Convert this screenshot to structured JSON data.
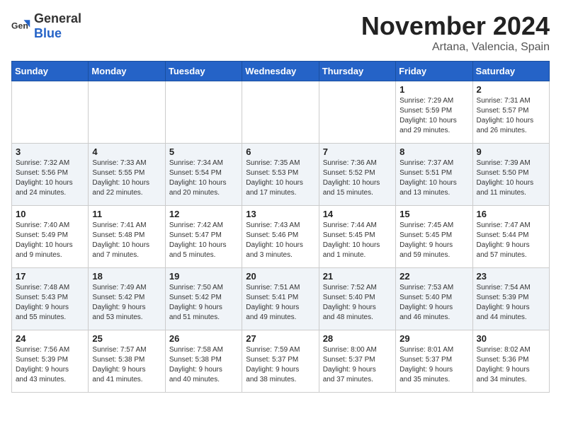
{
  "header": {
    "logo_general": "General",
    "logo_blue": "Blue",
    "month_title": "November 2024",
    "location": "Artana, Valencia, Spain"
  },
  "weekdays": [
    "Sunday",
    "Monday",
    "Tuesday",
    "Wednesday",
    "Thursday",
    "Friday",
    "Saturday"
  ],
  "weeks": [
    [
      {
        "day": "",
        "info": ""
      },
      {
        "day": "",
        "info": ""
      },
      {
        "day": "",
        "info": ""
      },
      {
        "day": "",
        "info": ""
      },
      {
        "day": "",
        "info": ""
      },
      {
        "day": "1",
        "info": "Sunrise: 7:29 AM\nSunset: 5:59 PM\nDaylight: 10 hours\nand 29 minutes."
      },
      {
        "day": "2",
        "info": "Sunrise: 7:31 AM\nSunset: 5:57 PM\nDaylight: 10 hours\nand 26 minutes."
      }
    ],
    [
      {
        "day": "3",
        "info": "Sunrise: 7:32 AM\nSunset: 5:56 PM\nDaylight: 10 hours\nand 24 minutes."
      },
      {
        "day": "4",
        "info": "Sunrise: 7:33 AM\nSunset: 5:55 PM\nDaylight: 10 hours\nand 22 minutes."
      },
      {
        "day": "5",
        "info": "Sunrise: 7:34 AM\nSunset: 5:54 PM\nDaylight: 10 hours\nand 20 minutes."
      },
      {
        "day": "6",
        "info": "Sunrise: 7:35 AM\nSunset: 5:53 PM\nDaylight: 10 hours\nand 17 minutes."
      },
      {
        "day": "7",
        "info": "Sunrise: 7:36 AM\nSunset: 5:52 PM\nDaylight: 10 hours\nand 15 minutes."
      },
      {
        "day": "8",
        "info": "Sunrise: 7:37 AM\nSunset: 5:51 PM\nDaylight: 10 hours\nand 13 minutes."
      },
      {
        "day": "9",
        "info": "Sunrise: 7:39 AM\nSunset: 5:50 PM\nDaylight: 10 hours\nand 11 minutes."
      }
    ],
    [
      {
        "day": "10",
        "info": "Sunrise: 7:40 AM\nSunset: 5:49 PM\nDaylight: 10 hours\nand 9 minutes."
      },
      {
        "day": "11",
        "info": "Sunrise: 7:41 AM\nSunset: 5:48 PM\nDaylight: 10 hours\nand 7 minutes."
      },
      {
        "day": "12",
        "info": "Sunrise: 7:42 AM\nSunset: 5:47 PM\nDaylight: 10 hours\nand 5 minutes."
      },
      {
        "day": "13",
        "info": "Sunrise: 7:43 AM\nSunset: 5:46 PM\nDaylight: 10 hours\nand 3 minutes."
      },
      {
        "day": "14",
        "info": "Sunrise: 7:44 AM\nSunset: 5:45 PM\nDaylight: 10 hours\nand 1 minute."
      },
      {
        "day": "15",
        "info": "Sunrise: 7:45 AM\nSunset: 5:45 PM\nDaylight: 9 hours\nand 59 minutes."
      },
      {
        "day": "16",
        "info": "Sunrise: 7:47 AM\nSunset: 5:44 PM\nDaylight: 9 hours\nand 57 minutes."
      }
    ],
    [
      {
        "day": "17",
        "info": "Sunrise: 7:48 AM\nSunset: 5:43 PM\nDaylight: 9 hours\nand 55 minutes."
      },
      {
        "day": "18",
        "info": "Sunrise: 7:49 AM\nSunset: 5:42 PM\nDaylight: 9 hours\nand 53 minutes."
      },
      {
        "day": "19",
        "info": "Sunrise: 7:50 AM\nSunset: 5:42 PM\nDaylight: 9 hours\nand 51 minutes."
      },
      {
        "day": "20",
        "info": "Sunrise: 7:51 AM\nSunset: 5:41 PM\nDaylight: 9 hours\nand 49 minutes."
      },
      {
        "day": "21",
        "info": "Sunrise: 7:52 AM\nSunset: 5:40 PM\nDaylight: 9 hours\nand 48 minutes."
      },
      {
        "day": "22",
        "info": "Sunrise: 7:53 AM\nSunset: 5:40 PM\nDaylight: 9 hours\nand 46 minutes."
      },
      {
        "day": "23",
        "info": "Sunrise: 7:54 AM\nSunset: 5:39 PM\nDaylight: 9 hours\nand 44 minutes."
      }
    ],
    [
      {
        "day": "24",
        "info": "Sunrise: 7:56 AM\nSunset: 5:39 PM\nDaylight: 9 hours\nand 43 minutes."
      },
      {
        "day": "25",
        "info": "Sunrise: 7:57 AM\nSunset: 5:38 PM\nDaylight: 9 hours\nand 41 minutes."
      },
      {
        "day": "26",
        "info": "Sunrise: 7:58 AM\nSunset: 5:38 PM\nDaylight: 9 hours\nand 40 minutes."
      },
      {
        "day": "27",
        "info": "Sunrise: 7:59 AM\nSunset: 5:37 PM\nDaylight: 9 hours\nand 38 minutes."
      },
      {
        "day": "28",
        "info": "Sunrise: 8:00 AM\nSunset: 5:37 PM\nDaylight: 9 hours\nand 37 minutes."
      },
      {
        "day": "29",
        "info": "Sunrise: 8:01 AM\nSunset: 5:37 PM\nDaylight: 9 hours\nand 35 minutes."
      },
      {
        "day": "30",
        "info": "Sunrise: 8:02 AM\nSunset: 5:36 PM\nDaylight: 9 hours\nand 34 minutes."
      }
    ]
  ]
}
